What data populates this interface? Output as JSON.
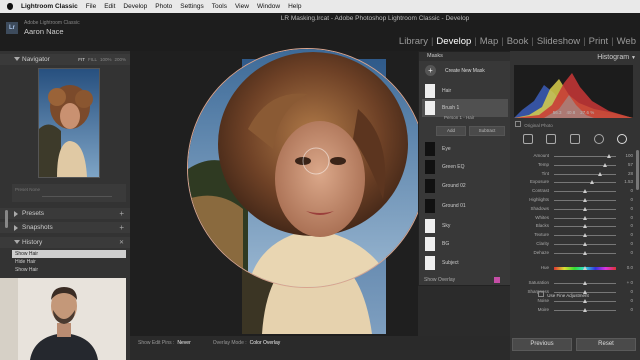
{
  "menubar": {
    "app": "Lightroom Classic",
    "items": [
      "File",
      "Edit",
      "Develop",
      "Photo",
      "Settings",
      "Tools",
      "View",
      "Window",
      "Help"
    ],
    "window_title": "LR Masking.lrcat - Adobe Photoshop Lightroom Classic - Develop"
  },
  "header": {
    "logo": "Lr",
    "catalog_label": "Adobe Lightroom Classic",
    "user_name": "Aaron Nace",
    "modules": [
      "Library",
      "Develop",
      "Map",
      "Book",
      "Slideshow",
      "Print",
      "Web"
    ],
    "active_module": "Develop",
    "sep": "|"
  },
  "left": {
    "navigator": {
      "title": "Navigator",
      "options": [
        "FIT",
        "FILL",
        "100%",
        "200%"
      ]
    },
    "odd_panel_label": "Preset  None",
    "presets": "Presets",
    "snapshots": "Snapshots",
    "history": {
      "title": "History",
      "items": [
        "Show Hair",
        "Hide Hair",
        "Show Hair"
      ]
    },
    "plus": "+"
  },
  "toolbar": {
    "show_edit_pins_label": "Show Edit Pins :",
    "show_edit_pins_value": "Never",
    "overlay_mode_label": "Overlay Mode :",
    "overlay_mode_value": "Color Overlay"
  },
  "masks": {
    "title": "Masks",
    "create_new": "Create New Mask",
    "plus": "+",
    "rows": [
      "Hair",
      "Brush 1",
      "Person 1 - Hair",
      "Eye",
      "Green EQ",
      "Ground 02",
      "Ground 01",
      "Sky",
      "BG",
      "Subject"
    ],
    "add_label": "Add",
    "subtract_label": "Subtract",
    "show_overlay": "Show Overlay",
    "overlay_color": "#c54ea6"
  },
  "right": {
    "histogram_title": "Histogram",
    "hist_values": [
      "56.3",
      "40.8",
      "27.6 %"
    ],
    "original_photo": "Original Photo",
    "sliders": [
      {
        "label": "Amount",
        "value": "100",
        "pos": 0.88
      },
      {
        "label": "Temp",
        "value": "57",
        "pos": 0.82
      },
      {
        "label": "Tint",
        "value": "28",
        "pos": 0.74
      },
      {
        "label": "Exposure",
        "value": "1.53",
        "pos": 0.62
      },
      {
        "label": "Contrast",
        "value": "0",
        "pos": 0.5
      },
      {
        "label": "Highlights",
        "value": "0",
        "pos": 0.5
      },
      {
        "label": "Shadows",
        "value": "0",
        "pos": 0.5
      },
      {
        "label": "Whites",
        "value": "0",
        "pos": 0.5
      },
      {
        "label": "Blacks",
        "value": "0",
        "pos": 0.5
      },
      {
        "label": "Texture",
        "value": "0",
        "pos": 0.5
      },
      {
        "label": "Clarity",
        "value": "0",
        "pos": 0.5
      },
      {
        "label": "Dehaze",
        "value": "0",
        "pos": 0.5
      },
      {
        "label": "Hue",
        "value": "0.0",
        "pos": 0.5
      },
      {
        "label": "Saturation",
        "value": "+ 0",
        "pos": 0.5
      },
      {
        "label": "Sharpness",
        "value": "0",
        "pos": 0.5
      },
      {
        "label": "Noise",
        "value": "0",
        "pos": 0.5
      },
      {
        "label": "Moire",
        "value": "0",
        "pos": 0.5
      }
    ],
    "fine_adjustment": "Use Fine Adjustment",
    "previous": "Previous",
    "reset": "Reset"
  }
}
